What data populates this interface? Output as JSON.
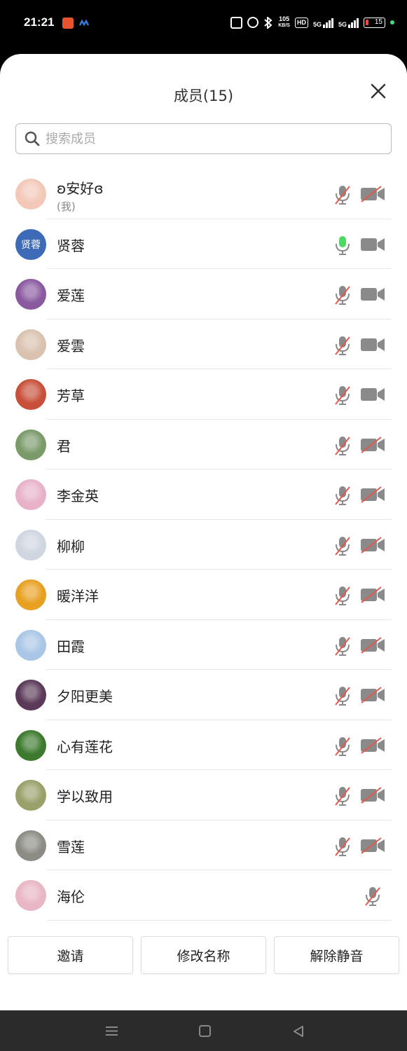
{
  "status_bar": {
    "time": "21:21",
    "speed_top": "105",
    "speed_bottom": "KB/S",
    "hd_label": "HD",
    "net1": "5G",
    "net2": "5G",
    "battery": "15"
  },
  "header": {
    "title": "成员(15)"
  },
  "search": {
    "placeholder": "搜索成员"
  },
  "members": [
    {
      "name": "ʚ安好ɞ",
      "sub": "(我)",
      "mic": "muted",
      "camera": "off",
      "avatar_color": "#f3c8b8"
    },
    {
      "name": "贤蓉",
      "avatar_text": "贤蓉",
      "mic": "active",
      "camera": "on",
      "avatar_color": "#3e6bb8"
    },
    {
      "name": "爱莲",
      "mic": "muted",
      "camera": "on",
      "avatar_color": "#8a5aa0"
    },
    {
      "name": "爱雲",
      "mic": "muted",
      "camera": "on",
      "avatar_color": "#d9c2b0"
    },
    {
      "name": "芳草",
      "mic": "muted",
      "camera": "on",
      "avatar_color": "#c8503a"
    },
    {
      "name": "君",
      "mic": "muted",
      "camera": "off",
      "avatar_color": "#7a9a6a"
    },
    {
      "name": "李金英",
      "mic": "muted",
      "camera": "off",
      "avatar_color": "#e7b2c8"
    },
    {
      "name": "柳柳",
      "mic": "muted",
      "camera": "off",
      "avatar_color": "#cfd6df"
    },
    {
      "name": "暖洋洋",
      "mic": "muted",
      "camera": "off",
      "avatar_color": "#e8a020"
    },
    {
      "name": "田霞",
      "mic": "muted",
      "camera": "off",
      "avatar_color": "#a9c6e6"
    },
    {
      "name": "夕阳更美",
      "mic": "muted",
      "camera": "off",
      "avatar_color": "#5a3a58"
    },
    {
      "name": "心有莲花",
      "mic": "muted",
      "camera": "off",
      "avatar_color": "#3d7a2e"
    },
    {
      "name": "学以致用",
      "mic": "muted",
      "camera": "off",
      "avatar_color": "#9aa06a"
    },
    {
      "name": "雪莲",
      "mic": "muted",
      "camera": "off",
      "avatar_color": "#8c8c84"
    },
    {
      "name": "海伦",
      "mic": "muted",
      "camera": "none",
      "avatar_color": "#e8b6c4"
    }
  ],
  "actions": {
    "invite": "邀请",
    "rename": "修改名称",
    "unmute": "解除静音"
  },
  "colors": {
    "mic_active": "#4cd964",
    "muted_slash": "#e05a4f",
    "icon_gray": "#8a8a8a"
  }
}
